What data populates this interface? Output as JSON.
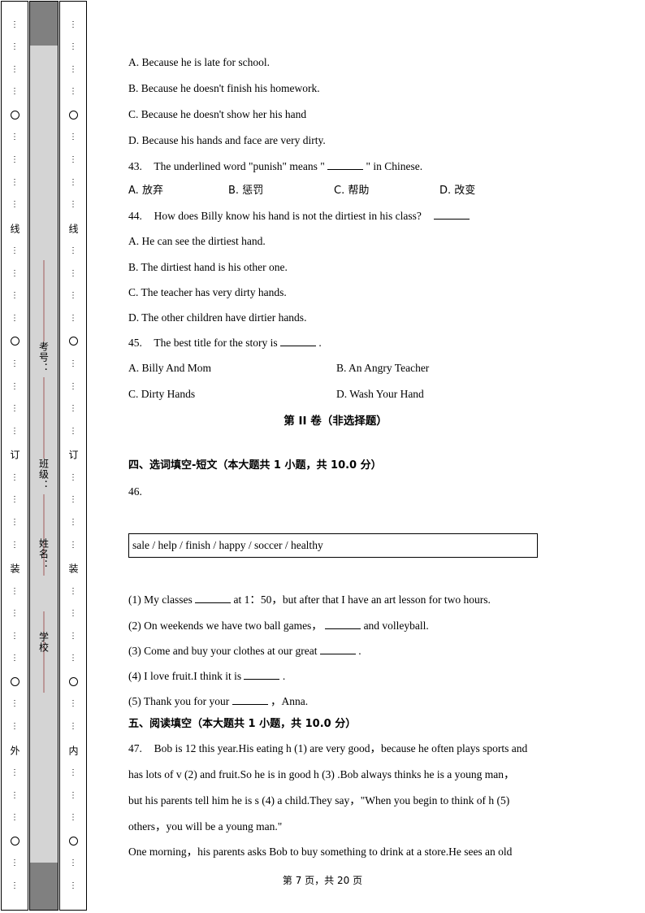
{
  "seal_margin": {
    "band_labels": [
      {
        "text": "考号："
      },
      {
        "text": "班级："
      },
      {
        "text": "姓名："
      },
      {
        "text": "学校"
      }
    ],
    "left_column_marks": [
      "线",
      "○",
      "订",
      "装",
      "外"
    ],
    "right_column_marks": [
      "线",
      "○",
      "订",
      "装",
      "内"
    ],
    "dot_glyph": "⋮",
    "rule_color": "#a05a5a",
    "band_color": "#d4d4d4",
    "band_cap_color": "#808080"
  },
  "reading_options_42": [
    {
      "label": "A.",
      "text": "Because he is late for school."
    },
    {
      "label": "B.",
      "text": "Because he doesn't finish his homework."
    },
    {
      "label": "C.",
      "text": "Because he doesn't show her his hand"
    },
    {
      "label": "D.",
      "text": "Because his hands and face are very dirty."
    }
  ],
  "question_43": {
    "number": "43.",
    "stem_before": "The underlined word \"punish\" means \"",
    "stem_after": "\" in Chinese.",
    "options": [
      {
        "label": "A.",
        "text": "放弃"
      },
      {
        "label": "B.",
        "text": "惩罚"
      },
      {
        "label": "C.",
        "text": "帮助"
      },
      {
        "label": "D.",
        "text": "改变"
      }
    ]
  },
  "question_44": {
    "number": "44.",
    "stem": "How does Billy know his hand is not the dirtiest in his class?",
    "options": [
      {
        "label": "A.",
        "text": "He can see the dirtiest hand."
      },
      {
        "label": "B.",
        "text": "The dirtiest hand is his other one."
      },
      {
        "label": "C.",
        "text": "The teacher has very dirty hands."
      },
      {
        "label": "D.",
        "text": "The other children have dirtier hands."
      }
    ]
  },
  "question_45": {
    "number": "45.",
    "stem_before": "The best title for the story is",
    "stem_after": ".",
    "options": [
      {
        "label": "A.",
        "text": "Billy And Mom"
      },
      {
        "label": "B.",
        "text": "An Angry Teacher"
      },
      {
        "label": "C.",
        "text": "Dirty Hands"
      },
      {
        "label": "D.",
        "text": "Wash Your Hand"
      }
    ]
  },
  "part_two_heading": "第 II 卷（非选择题）",
  "section_four": {
    "heading": "四、选词填空-短文（本大题共 1 小题，共 10.0 分）",
    "question_number": "46.",
    "word_bank": "sale / help / finish / happy / soccer / healthy",
    "items": [
      {
        "number": "(1)",
        "before": "My classes",
        "after": "at 1：50，but after that I have an art lesson for two hours."
      },
      {
        "number": "(2)",
        "before": "On weekends we have two ball games，",
        "after": "and volleyball."
      },
      {
        "number": "(3)",
        "before": "Come and buy your clothes at our great",
        "after": "."
      },
      {
        "number": "(4)",
        "before": "I love fruit.I think it is",
        "after": "."
      },
      {
        "number": "(5)",
        "before": "Thank you for your",
        "after": "，Anna."
      }
    ]
  },
  "section_five": {
    "heading": "五、阅读填空（本大题共 1 小题，共 10.0 分）",
    "question_number": "47.",
    "passage_lines": [
      "Bob is 12 this year.His eating h (1) are very good，because he often plays sports and",
      "has lots of v (2) and fruit.So he is in good h (3) .Bob always thinks he is a young man，",
      "but his parents tell him he is s (4) a child.They say，\"When you begin to think of h (5)",
      "others，you will be a young man.\"",
      "One morning，his parents asks Bob to buy something to drink at a store.He sees an old"
    ]
  },
  "footer": "第 7 页，共 20 页"
}
